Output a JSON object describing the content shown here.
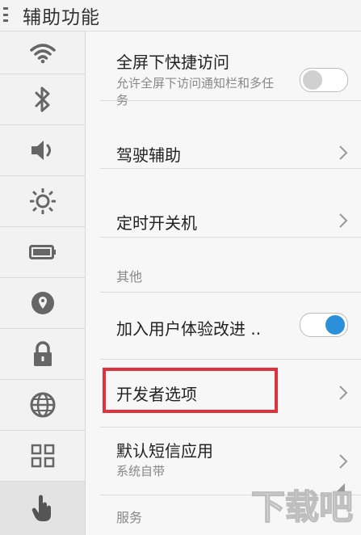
{
  "header": {
    "title": "辅助功能"
  },
  "sidebar": {
    "items": [
      {
        "icon": "wifi-icon"
      },
      {
        "icon": "bluetooth-icon"
      },
      {
        "icon": "volume-icon"
      },
      {
        "icon": "brightness-icon"
      },
      {
        "icon": "battery-icon"
      },
      {
        "icon": "location-icon"
      },
      {
        "icon": "lock-icon"
      },
      {
        "icon": "globe-icon"
      },
      {
        "icon": "apps-grid-icon"
      },
      {
        "icon": "hand-gesture-icon",
        "active": true
      }
    ]
  },
  "settings": {
    "fullscreen_access": {
      "label": "全屏下快捷访问",
      "desc": "允许全屏下访问通知栏和多任务",
      "enabled": false
    },
    "driving_assist": {
      "label": "驾驶辅助"
    },
    "scheduled_power": {
      "label": "定时开关机"
    },
    "section_other": "其他",
    "user_experience": {
      "label": "加入用户体验改进 ..",
      "enabled": true
    },
    "developer_options": {
      "label": "开发者选项"
    },
    "default_sms": {
      "label": "默认短信应用",
      "desc": "系统自带"
    },
    "section_service": "服务"
  },
  "colors": {
    "accent": "#2b90d9",
    "highlight": "#e0323c"
  },
  "watermark": {
    "text": "下载吧"
  }
}
